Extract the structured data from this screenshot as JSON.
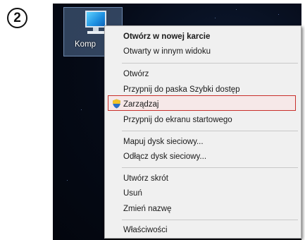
{
  "step_badge": "2",
  "desktop": {
    "icon_label": "Komp",
    "icon": "computer-icon"
  },
  "menu": {
    "items": [
      {
        "label": "Otwórz w nowej karcie",
        "bold": true
      },
      {
        "label": "Otwarty w innym widoku"
      },
      {
        "label": "Otwórz"
      },
      {
        "label": "Przypnij do paska Szybki dostęp"
      },
      {
        "label": "Zarządzaj",
        "icon": "uac-shield-icon",
        "highlighted": true
      },
      {
        "label": "Przypnij do ekranu startowego"
      },
      {
        "label": "Mapuj dysk sieciowy..."
      },
      {
        "label": "Odłącz dysk sieciowy..."
      },
      {
        "label": "Utwórz skrót"
      },
      {
        "label": "Usuń"
      },
      {
        "label": "Zmień nazwę"
      },
      {
        "label": "Właściwości"
      }
    ],
    "highlight_color": "#c9302c"
  }
}
